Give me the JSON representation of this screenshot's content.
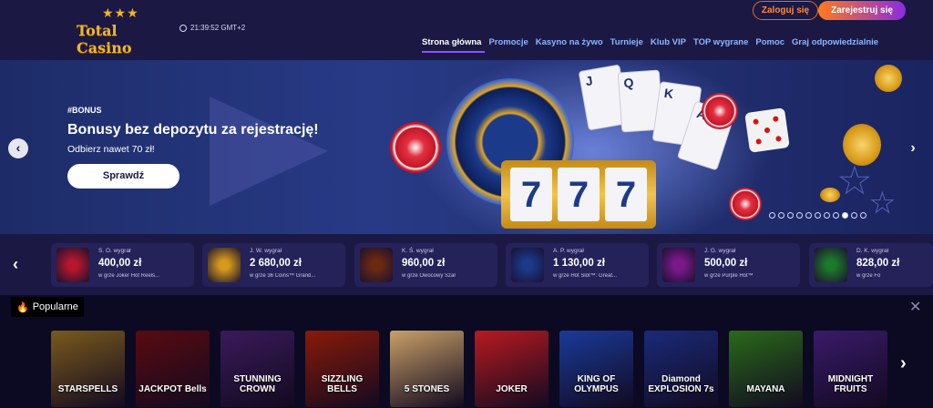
{
  "header": {
    "logo_text": "Total Casino",
    "clock": "21:39:52 GMT+2",
    "login_label": "Zaloguj się",
    "register_label": "Zarejestruj się",
    "nav": [
      "Strona główna",
      "Promocje",
      "Kasyno na żywo",
      "Turnieje",
      "Klub VIP",
      "TOP wygrane",
      "Pomoc",
      "Graj odpowiedzialnie"
    ]
  },
  "hero": {
    "tag": "#BONUS",
    "title": "Bonusy bez depozytu za rejestrację!",
    "subtitle": "Odbierz nawet 70 zł!",
    "cta": "Sprawdź",
    "slot_digits": [
      "7",
      "7",
      "7"
    ],
    "card_ranks": [
      "J",
      "Q",
      "K",
      "A"
    ],
    "dots_total": 11,
    "dots_active": 9
  },
  "winners": [
    {
      "who": "S. O. wygrał",
      "amount": "400,00 zł",
      "game": "w grze Joker Hot Reels...",
      "color": "#b5172b"
    },
    {
      "who": "J. W. wygrał",
      "amount": "2 680,00 zł",
      "game": "w grze 36 Coins™ Grand...",
      "color": "#d49a1c"
    },
    {
      "who": "K. Ś. wygrał",
      "amount": "960,00 zł",
      "game": "w grze Owocowy Szał",
      "color": "#6b2a10"
    },
    {
      "who": "A. P. wygrał",
      "amount": "1 130,00 zł",
      "game": "w grze Hot Slot™: Great...",
      "color": "#1a3a8a"
    },
    {
      "who": "J. G. wygrał",
      "amount": "500,00 zł",
      "game": "w grze Purple Hot™",
      "color": "#7a1a8a"
    },
    {
      "who": "D. K. wygrał",
      "amount": "828,00 zł",
      "game": "w grze Fo",
      "color": "#1d7a2a"
    }
  ],
  "popular": {
    "tab_label": "Popularne",
    "close": "✕",
    "games": [
      {
        "title": "STARSPELLS",
        "bg": "#7a5a1c"
      },
      {
        "title": "JACKPOT Bells",
        "bg": "#5a0a10"
      },
      {
        "title": "STUNNING CROWN",
        "bg": "#3a1a5a"
      },
      {
        "title": "SIZZLING BELLS",
        "bg": "#8a1a08"
      },
      {
        "title": "5 STONES",
        "bg": "#c9a068"
      },
      {
        "title": "JOKER",
        "bg": "#b81a20"
      },
      {
        "title": "KING OF OLYMPUS",
        "bg": "#1a3a9a"
      },
      {
        "title": "Diamond EXPLOSION 7s",
        "bg": "#1a2a7a"
      },
      {
        "title": "MAYANA",
        "bg": "#2a6a1a"
      },
      {
        "title": "MIDNIGHT FRUITS",
        "bg": "#3a1a6a"
      }
    ]
  },
  "colors": {
    "accent": "#8c52ff",
    "orange": "#ff7a1a",
    "nav_link": "#8fb5ff"
  }
}
